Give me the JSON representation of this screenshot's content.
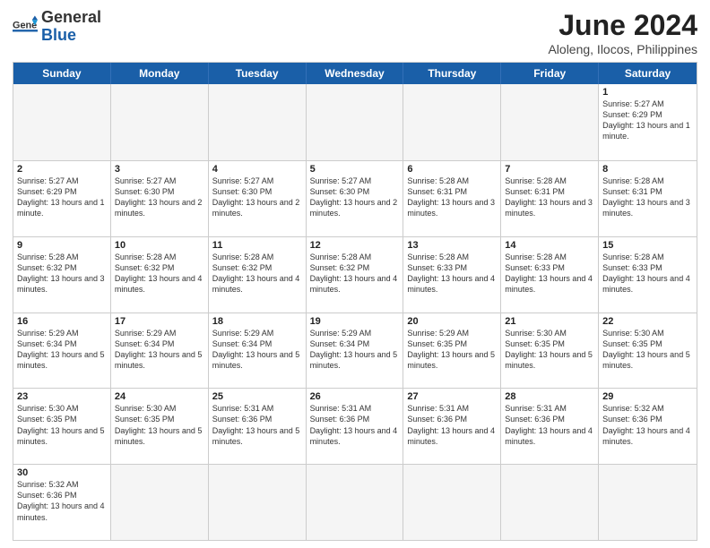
{
  "logo": {
    "text_general": "General",
    "text_blue": "Blue"
  },
  "title": {
    "month_year": "June 2024",
    "location": "Aloleng, Ilocos, Philippines"
  },
  "header_days": [
    "Sunday",
    "Monday",
    "Tuesday",
    "Wednesday",
    "Thursday",
    "Friday",
    "Saturday"
  ],
  "weeks": [
    [
      {
        "day": "",
        "empty": true
      },
      {
        "day": "",
        "empty": true
      },
      {
        "day": "",
        "empty": true
      },
      {
        "day": "",
        "empty": true
      },
      {
        "day": "",
        "empty": true
      },
      {
        "day": "",
        "empty": true
      },
      {
        "day": "1",
        "info": "Sunrise: 5:27 AM\nSunset: 6:29 PM\nDaylight: 13 hours and 1 minute."
      }
    ],
    [
      {
        "day": "2",
        "info": "Sunrise: 5:27 AM\nSunset: 6:29 PM\nDaylight: 13 hours and 1 minute."
      },
      {
        "day": "3",
        "info": "Sunrise: 5:27 AM\nSunset: 6:30 PM\nDaylight: 13 hours and 2 minutes."
      },
      {
        "day": "4",
        "info": "Sunrise: 5:27 AM\nSunset: 6:30 PM\nDaylight: 13 hours and 2 minutes."
      },
      {
        "day": "5",
        "info": "Sunrise: 5:27 AM\nSunset: 6:30 PM\nDaylight: 13 hours and 2 minutes."
      },
      {
        "day": "6",
        "info": "Sunrise: 5:28 AM\nSunset: 6:31 PM\nDaylight: 13 hours and 3 minutes."
      },
      {
        "day": "7",
        "info": "Sunrise: 5:28 AM\nSunset: 6:31 PM\nDaylight: 13 hours and 3 minutes."
      },
      {
        "day": "8",
        "info": "Sunrise: 5:28 AM\nSunset: 6:31 PM\nDaylight: 13 hours and 3 minutes."
      }
    ],
    [
      {
        "day": "9",
        "info": "Sunrise: 5:28 AM\nSunset: 6:32 PM\nDaylight: 13 hours and 3 minutes."
      },
      {
        "day": "10",
        "info": "Sunrise: 5:28 AM\nSunset: 6:32 PM\nDaylight: 13 hours and 4 minutes."
      },
      {
        "day": "11",
        "info": "Sunrise: 5:28 AM\nSunset: 6:32 PM\nDaylight: 13 hours and 4 minutes."
      },
      {
        "day": "12",
        "info": "Sunrise: 5:28 AM\nSunset: 6:32 PM\nDaylight: 13 hours and 4 minutes."
      },
      {
        "day": "13",
        "info": "Sunrise: 5:28 AM\nSunset: 6:33 PM\nDaylight: 13 hours and 4 minutes."
      },
      {
        "day": "14",
        "info": "Sunrise: 5:28 AM\nSunset: 6:33 PM\nDaylight: 13 hours and 4 minutes."
      },
      {
        "day": "15",
        "info": "Sunrise: 5:28 AM\nSunset: 6:33 PM\nDaylight: 13 hours and 4 minutes."
      }
    ],
    [
      {
        "day": "16",
        "info": "Sunrise: 5:29 AM\nSunset: 6:34 PM\nDaylight: 13 hours and 5 minutes."
      },
      {
        "day": "17",
        "info": "Sunrise: 5:29 AM\nSunset: 6:34 PM\nDaylight: 13 hours and 5 minutes."
      },
      {
        "day": "18",
        "info": "Sunrise: 5:29 AM\nSunset: 6:34 PM\nDaylight: 13 hours and 5 minutes."
      },
      {
        "day": "19",
        "info": "Sunrise: 5:29 AM\nSunset: 6:34 PM\nDaylight: 13 hours and 5 minutes."
      },
      {
        "day": "20",
        "info": "Sunrise: 5:29 AM\nSunset: 6:35 PM\nDaylight: 13 hours and 5 minutes."
      },
      {
        "day": "21",
        "info": "Sunrise: 5:30 AM\nSunset: 6:35 PM\nDaylight: 13 hours and 5 minutes."
      },
      {
        "day": "22",
        "info": "Sunrise: 5:30 AM\nSunset: 6:35 PM\nDaylight: 13 hours and 5 minutes."
      }
    ],
    [
      {
        "day": "23",
        "info": "Sunrise: 5:30 AM\nSunset: 6:35 PM\nDaylight: 13 hours and 5 minutes."
      },
      {
        "day": "24",
        "info": "Sunrise: 5:30 AM\nSunset: 6:35 PM\nDaylight: 13 hours and 5 minutes."
      },
      {
        "day": "25",
        "info": "Sunrise: 5:31 AM\nSunset: 6:36 PM\nDaylight: 13 hours and 5 minutes."
      },
      {
        "day": "26",
        "info": "Sunrise: 5:31 AM\nSunset: 6:36 PM\nDaylight: 13 hours and 4 minutes."
      },
      {
        "day": "27",
        "info": "Sunrise: 5:31 AM\nSunset: 6:36 PM\nDaylight: 13 hours and 4 minutes."
      },
      {
        "day": "28",
        "info": "Sunrise: 5:31 AM\nSunset: 6:36 PM\nDaylight: 13 hours and 4 minutes."
      },
      {
        "day": "29",
        "info": "Sunrise: 5:32 AM\nSunset: 6:36 PM\nDaylight: 13 hours and 4 minutes."
      }
    ],
    [
      {
        "day": "30",
        "info": "Sunrise: 5:32 AM\nSunset: 6:36 PM\nDaylight: 13 hours and 4 minutes."
      },
      {
        "day": "",
        "empty": true
      },
      {
        "day": "",
        "empty": true
      },
      {
        "day": "",
        "empty": true
      },
      {
        "day": "",
        "empty": true
      },
      {
        "day": "",
        "empty": true
      },
      {
        "day": "",
        "empty": true
      }
    ]
  ]
}
